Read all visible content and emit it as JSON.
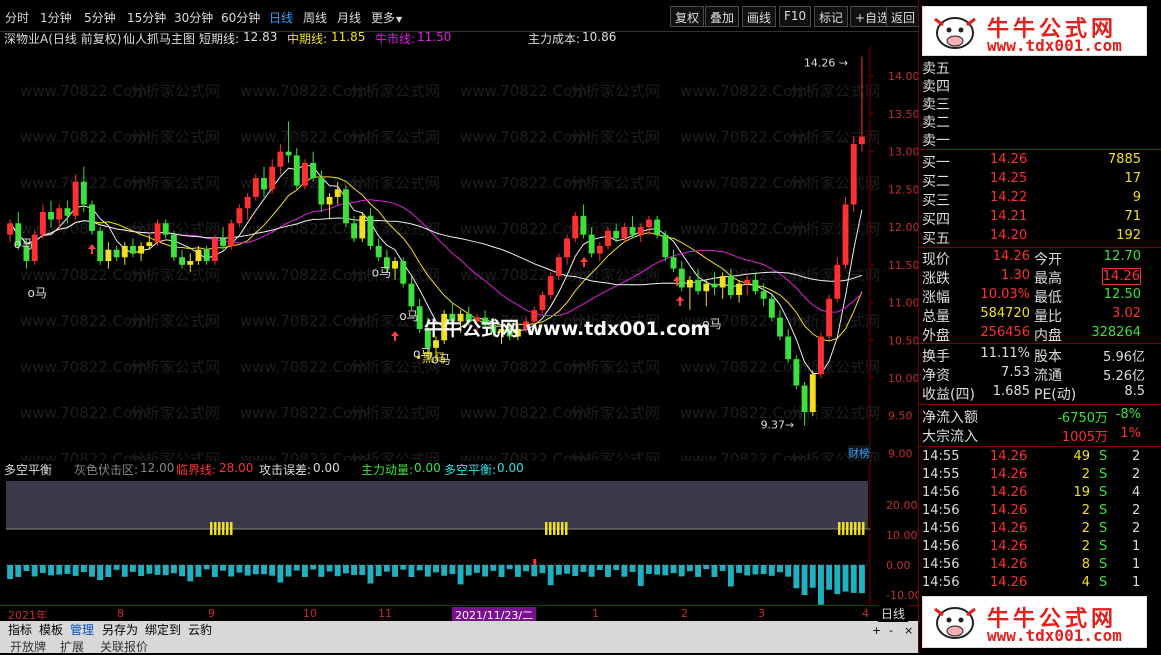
{
  "periods": [
    {
      "label": "分时",
      "active": false
    },
    {
      "label": "1分钟",
      "active": false
    },
    {
      "label": "5分钟",
      "active": false
    },
    {
      "label": "15分钟",
      "active": false
    },
    {
      "label": "30分钟",
      "active": false
    },
    {
      "label": "60分钟",
      "active": false
    },
    {
      "label": "日线",
      "active": true
    },
    {
      "label": "周线",
      "active": false
    },
    {
      "label": "月线",
      "active": false
    },
    {
      "label": "更多",
      "active": false
    }
  ],
  "more_arrow": "▼",
  "toolbar": [
    "复权",
    "叠加",
    "画线",
    "F10",
    "标记",
    "+自选",
    "返回"
  ],
  "title": {
    "stock": "深物业A(日线 前复权)",
    "indicator": "仙人抓马主图",
    "short_label": "短期线:",
    "short_val": "12.83",
    "mid_label": "中期线:",
    "mid_val": "11.85",
    "bull_label": "牛市线:",
    "bull_val": "11.50",
    "cost_label": "主力成本:",
    "cost_val": "10.86"
  },
  "chart_data": {
    "type": "candlestick",
    "yticks": [
      "14.00",
      "13.50",
      "13.00",
      "12.50",
      "12.00",
      "11.50",
      "11.00",
      "10.50",
      "10.00",
      "9.50",
      "9.00"
    ],
    "ylim": [
      8.9,
      14.4
    ],
    "high_label": "14.26",
    "low_label": "9.37",
    "ma_colors": {
      "short": "#f0f0f0",
      "mid": "#f0e020",
      "bull": "#e020e0",
      "cost": "#f0f0f0"
    },
    "ohlc": [
      [
        11.9,
        12.1,
        11.8,
        12.05
      ],
      [
        12.05,
        12.2,
        11.7,
        11.75
      ],
      [
        11.75,
        11.85,
        11.45,
        11.55
      ],
      [
        11.55,
        11.95,
        11.5,
        11.9
      ],
      [
        11.9,
        12.3,
        11.85,
        12.2
      ],
      [
        12.2,
        12.35,
        12.0,
        12.1
      ],
      [
        12.1,
        12.3,
        12.0,
        12.25
      ],
      [
        12.25,
        12.35,
        12.05,
        12.15
      ],
      [
        12.15,
        12.7,
        12.1,
        12.6
      ],
      [
        12.6,
        12.8,
        12.2,
        12.3
      ],
      [
        12.3,
        12.35,
        11.9,
        11.95
      ],
      [
        11.95,
        12.0,
        11.5,
        11.55
      ],
      [
        11.55,
        11.8,
        11.45,
        11.7
      ],
      [
        11.7,
        11.75,
        11.55,
        11.6
      ],
      [
        11.6,
        11.8,
        11.5,
        11.75
      ],
      [
        11.75,
        11.85,
        11.6,
        11.65
      ],
      [
        11.65,
        11.8,
        11.55,
        11.75
      ],
      [
        11.75,
        11.9,
        11.7,
        11.8
      ],
      [
        11.8,
        12.1,
        11.75,
        12.05
      ],
      [
        12.05,
        12.1,
        11.85,
        11.9
      ],
      [
        11.9,
        11.95,
        11.55,
        11.6
      ],
      [
        11.6,
        11.7,
        11.45,
        11.5
      ],
      [
        11.5,
        11.65,
        11.4,
        11.55
      ],
      [
        11.55,
        11.75,
        11.5,
        11.7
      ],
      [
        11.7,
        11.75,
        11.5,
        11.55
      ],
      [
        11.55,
        11.9,
        11.5,
        11.85
      ],
      [
        11.85,
        12.0,
        11.7,
        11.75
      ],
      [
        11.75,
        12.1,
        11.7,
        12.05
      ],
      [
        12.05,
        12.3,
        12.0,
        12.25
      ],
      [
        12.25,
        12.45,
        12.1,
        12.4
      ],
      [
        12.4,
        12.7,
        12.35,
        12.65
      ],
      [
        12.65,
        12.8,
        12.4,
        12.5
      ],
      [
        12.5,
        12.9,
        12.45,
        12.8
      ],
      [
        12.8,
        13.1,
        12.7,
        13.0
      ],
      [
        13.0,
        13.4,
        12.85,
        12.95
      ],
      [
        12.95,
        13.05,
        12.5,
        12.55
      ],
      [
        12.55,
        12.9,
        12.5,
        12.85
      ],
      [
        12.85,
        13.0,
        12.6,
        12.65
      ],
      [
        12.65,
        12.75,
        12.2,
        12.3
      ],
      [
        12.3,
        12.45,
        12.1,
        12.4
      ],
      [
        12.4,
        12.6,
        12.3,
        12.5
      ],
      [
        12.5,
        12.55,
        12.0,
        12.05
      ],
      [
        12.05,
        12.15,
        11.8,
        11.85
      ],
      [
        11.85,
        12.2,
        11.8,
        12.15
      ],
      [
        12.15,
        12.25,
        11.7,
        11.75
      ],
      [
        11.75,
        11.85,
        11.55,
        11.6
      ],
      [
        11.6,
        11.7,
        11.4,
        11.45
      ],
      [
        11.45,
        11.6,
        11.3,
        11.55
      ],
      [
        11.55,
        11.6,
        11.2,
        11.25
      ],
      [
        11.25,
        11.35,
        10.9,
        10.95
      ],
      [
        10.95,
        11.05,
        10.6,
        10.65
      ],
      [
        10.65,
        10.8,
        10.3,
        10.4
      ],
      [
        10.4,
        10.55,
        10.25,
        10.5
      ],
      [
        10.5,
        10.9,
        10.45,
        10.85
      ],
      [
        10.85,
        11.0,
        10.7,
        10.75
      ],
      [
        10.75,
        10.9,
        10.6,
        10.85
      ],
      [
        10.85,
        10.95,
        10.7,
        10.75
      ],
      [
        10.75,
        10.85,
        10.6,
        10.8
      ],
      [
        10.8,
        10.9,
        10.65,
        10.7
      ],
      [
        10.7,
        10.8,
        10.55,
        10.6
      ],
      [
        10.6,
        10.7,
        10.45,
        10.65
      ],
      [
        10.65,
        10.75,
        10.5,
        10.55
      ],
      [
        10.55,
        10.7,
        10.5,
        10.65
      ],
      [
        10.65,
        10.8,
        10.6,
        10.75
      ],
      [
        10.75,
        10.95,
        10.7,
        10.9
      ],
      [
        10.9,
        11.15,
        10.85,
        11.1
      ],
      [
        11.1,
        11.4,
        11.05,
        11.35
      ],
      [
        11.35,
        11.65,
        11.3,
        11.6
      ],
      [
        11.6,
        11.9,
        11.5,
        11.85
      ],
      [
        11.85,
        12.2,
        11.8,
        12.15
      ],
      [
        12.15,
        12.3,
        11.85,
        11.9
      ],
      [
        11.9,
        12.0,
        11.6,
        11.65
      ],
      [
        11.65,
        11.8,
        11.55,
        11.75
      ],
      [
        11.75,
        12.0,
        11.7,
        11.95
      ],
      [
        11.95,
        12.05,
        11.8,
        11.85
      ],
      [
        11.85,
        12.05,
        11.8,
        12.0
      ],
      [
        12.0,
        12.15,
        11.85,
        11.9
      ],
      [
        11.9,
        12.05,
        11.8,
        12.0
      ],
      [
        12.0,
        12.15,
        11.9,
        12.1
      ],
      [
        12.1,
        12.15,
        11.85,
        11.9
      ],
      [
        11.9,
        11.95,
        11.55,
        11.6
      ],
      [
        11.6,
        11.7,
        11.4,
        11.45
      ],
      [
        11.45,
        11.55,
        11.15,
        11.2
      ],
      [
        11.2,
        11.35,
        10.9,
        11.3
      ],
      [
        11.3,
        11.45,
        11.1,
        11.15
      ],
      [
        11.15,
        11.3,
        10.95,
        11.25
      ],
      [
        11.25,
        11.4,
        11.1,
        11.2
      ],
      [
        11.2,
        11.4,
        11.05,
        11.35
      ],
      [
        11.35,
        11.45,
        11.05,
        11.1
      ],
      [
        11.1,
        11.3,
        11.0,
        11.25
      ],
      [
        11.25,
        11.35,
        11.1,
        11.3
      ],
      [
        11.3,
        11.4,
        11.1,
        11.15
      ],
      [
        11.15,
        11.25,
        10.95,
        11.05
      ],
      [
        11.05,
        11.1,
        10.75,
        10.8
      ],
      [
        10.8,
        10.9,
        10.5,
        10.55
      ],
      [
        10.55,
        10.65,
        10.2,
        10.25
      ],
      [
        10.25,
        10.3,
        9.85,
        9.9
      ],
      [
        9.9,
        9.95,
        9.37,
        9.55
      ],
      [
        9.55,
        10.1,
        9.5,
        10.05
      ],
      [
        10.05,
        10.6,
        10.0,
        10.55
      ],
      [
        10.55,
        11.1,
        10.5,
        11.05
      ],
      [
        11.05,
        11.6,
        11.0,
        11.5
      ],
      [
        11.5,
        12.4,
        11.45,
        12.3
      ],
      [
        12.3,
        13.2,
        12.2,
        13.1
      ],
      [
        13.1,
        14.26,
        13.0,
        13.2
      ]
    ],
    "signals": [
      {
        "label": "马",
        "x": 0.015,
        "y": 0.487
      },
      {
        "label": "马",
        "x": 0.03,
        "y": 0.605
      },
      {
        "label": "马",
        "x": 0.405,
        "y": 0.555
      },
      {
        "label": "马",
        "x": 0.435,
        "y": 0.66
      },
      {
        "label": "马",
        "x": 0.45,
        "y": 0.75
      },
      {
        "label": "马",
        "x": 0.47,
        "y": 0.765
      },
      {
        "label": "马",
        "x": 0.765,
        "y": 0.68
      }
    ],
    "black_horse": {
      "label": "黑马"
    }
  },
  "watermark_center": "牛牛公式网 www.tdx001.com",
  "watermark_bg": "www.70822.Com",
  "watermark_bg2": "分析家公式网",
  "sub": {
    "name": "多空平衡",
    "gray_label": "灰色伏击区:",
    "gray_val": "12.00",
    "crit_label": "临界线:",
    "crit_val": "28.00",
    "err_label": "攻击误差:",
    "err_val": "0.00",
    "main_label": "主力动量:",
    "main_val": "0.00",
    "bal_label": "多空平衡:",
    "bal_val": "0.00",
    "yticks": [
      "20.00",
      "10.00",
      "0.00",
      "-10.00"
    ]
  },
  "dates": [
    "2021年",
    "8",
    "9",
    "10",
    "11",
    "2021/11/23/二",
    "1",
    "2",
    "3",
    "4"
  ],
  "cai_label": "财榜",
  "bottom_tabs": [
    "指标",
    "模板",
    "管理",
    "另存为",
    "绑定到",
    "云豹"
  ],
  "bottom_row2": [
    "开放牌",
    "扩展",
    "关联报价"
  ],
  "period_right": "日线",
  "logo": {
    "title": "牛牛公式网",
    "url": "www.tdx001.com"
  },
  "orderbook": {
    "sells": [
      "卖五",
      "卖四",
      "卖三",
      "卖二",
      "卖一"
    ],
    "buys": [
      {
        "label": "买一",
        "price": "14.26",
        "vol": "7885"
      },
      {
        "label": "买二",
        "price": "14.25",
        "vol": "17"
      },
      {
        "label": "买三",
        "price": "14.22",
        "vol": "9"
      },
      {
        "label": "买四",
        "price": "14.21",
        "vol": "71"
      },
      {
        "label": "买五",
        "price": "14.20",
        "vol": "192"
      }
    ]
  },
  "quote": [
    {
      "l1": "现价",
      "v1": "14.26",
      "l2": "今开",
      "v2": "12.70",
      "c1": "red",
      "c2": "green"
    },
    {
      "l1": "涨跌",
      "v1": "1.30",
      "l2": "最高",
      "v2": "14.26",
      "c1": "red",
      "c2": "red"
    },
    {
      "l1": "涨幅",
      "v1": "10.03%",
      "l2": "最低",
      "v2": "12.50",
      "c1": "red",
      "c2": "green"
    },
    {
      "l1": "总量",
      "v1": "584720",
      "l2": "量比",
      "v2": "3.02",
      "c1": "yellow",
      "c2": "red"
    },
    {
      "l1": "外盘",
      "v1": "256456",
      "l2": "内盘",
      "v2": "328264",
      "c1": "red",
      "c2": "green"
    }
  ],
  "fundamentals": [
    {
      "l1": "换手",
      "v1": "11.11%",
      "l2": "股本",
      "v2": "5.96亿"
    },
    {
      "l1": "净资",
      "v1": "7.53",
      "l2": "流通",
      "v2": "5.26亿"
    },
    {
      "l1": "收益(四)",
      "v1": "1.685",
      "l2": "PE(动)",
      "v2": "8.5"
    }
  ],
  "flows": [
    {
      "label": "净流入额",
      "val": "-6750万",
      "pct": "-8%",
      "c": "green"
    },
    {
      "label": "大宗流入",
      "val": "1005万",
      "pct": "1%",
      "c": "red"
    }
  ],
  "ticks": [
    {
      "time": "14:55",
      "price": "14.26",
      "vol": "49",
      "bs": "S",
      "n": "2"
    },
    {
      "time": "14:55",
      "price": "14.26",
      "vol": "2",
      "bs": "S",
      "n": "2"
    },
    {
      "time": "14:56",
      "price": "14.26",
      "vol": "19",
      "bs": "S",
      "n": "4"
    },
    {
      "time": "14:56",
      "price": "14.26",
      "vol": "2",
      "bs": "S",
      "n": "2"
    },
    {
      "time": "14:56",
      "price": "14.26",
      "vol": "2",
      "bs": "S",
      "n": "2"
    },
    {
      "time": "14:56",
      "price": "14.26",
      "vol": "2",
      "bs": "S",
      "n": "1"
    },
    {
      "time": "14:56",
      "price": "14.26",
      "vol": "8",
      "bs": "S",
      "n": "1"
    },
    {
      "time": "14:56",
      "price": "14.26",
      "vol": "4",
      "bs": "S",
      "n": "1"
    }
  ]
}
